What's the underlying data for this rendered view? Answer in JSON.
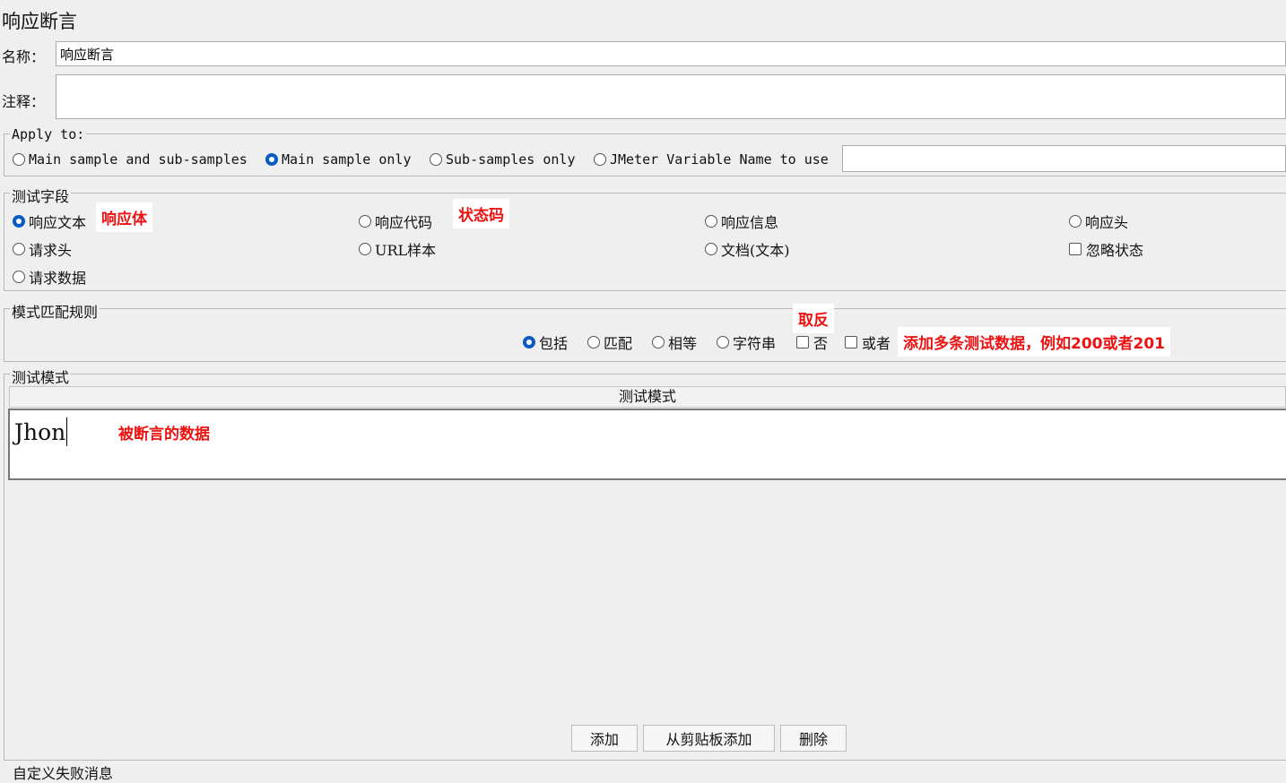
{
  "panel": {
    "title": "响应断言",
    "name_label": "名称：",
    "name_value": "响应断言",
    "comment_label": "注释：",
    "comment_value": ""
  },
  "apply_to": {
    "legend": "Apply to:",
    "options": [
      "Main sample and sub-samples",
      "Main sample only",
      "Sub-samples only",
      "JMeter Variable Name to use"
    ],
    "selected": "Main sample only",
    "variable_value": ""
  },
  "test_field": {
    "legend": "测试字段",
    "options": [
      "响应文本",
      "响应代码",
      "响应信息",
      "响应头",
      "请求头",
      "URL样本",
      "文档(文本)",
      "请求数据"
    ],
    "checkbox": "忽略状态",
    "selected": "响应文本"
  },
  "pattern_rules": {
    "legend": "模式匹配规则",
    "options": [
      "包括",
      "匹配",
      "相等",
      "字符串"
    ],
    "selected": "包括",
    "checkbox_not": "否",
    "checkbox_or": "或者"
  },
  "test_patterns": {
    "legend": "测试模式",
    "column_header": "测试模式",
    "rows": [
      "Jhon"
    ]
  },
  "buttons": {
    "add": "添加",
    "add_from_clipboard": "从剪贴板添加",
    "delete": "删除"
  },
  "footer": {
    "custom_failure_message": "自定义失败消息"
  },
  "annotations": {
    "response_body": "响应体",
    "status_code": "状态码",
    "negate": "取反",
    "multi_data": "添加多条测试数据，例如200或者201",
    "asserted_data": "被断言的数据"
  },
  "colors": {
    "accent": "#0a5cc4",
    "annotation": "#e11111",
    "background": "#efefef"
  }
}
